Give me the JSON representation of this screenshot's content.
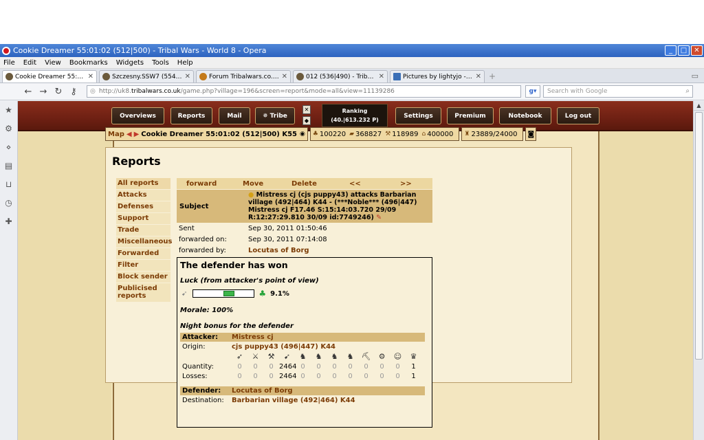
{
  "browser": {
    "window_title": "Cookie Dreamer 55:01:02 (512|500) - Tribal Wars - World 8 - Opera",
    "menu": [
      "File",
      "Edit",
      "View",
      "Bookmarks",
      "Widgets",
      "Tools",
      "Help"
    ],
    "tabs": [
      {
        "label": "Cookie Dreamer 55:01:0..."
      },
      {
        "label": "Szczesny.SSW7 (554|61..."
      },
      {
        "label": "Forum Tribalwars.co.uk -..."
      },
      {
        "label": "012 (536|490) - Tribal W..."
      },
      {
        "label": "Pictures by lightyjo - Pho..."
      }
    ],
    "url_prefix": "http://uk8.",
    "url_domain": "tribalwars.co.uk",
    "url_path": "/game.php?village=196&screen=report&mode=all&view=11139286",
    "search_placeholder": "Search with Google"
  },
  "game": {
    "nav": {
      "overviews": "Overviews",
      "reports": "Reports",
      "mail": "Mail",
      "tribe": "Tribe",
      "ranking_label": "Ranking",
      "ranking_value": "(40.|613.232 P)",
      "settings": "Settings",
      "premium": "Premium",
      "notebook": "Notebook",
      "logout": "Log out"
    },
    "infobar": {
      "map": "Map",
      "village": "Cookie Dreamer 55:01:02 (512|500) K55",
      "wood": "100220",
      "clay": "368827",
      "iron": "118989",
      "storage": "400000",
      "farm": "23889/24000"
    },
    "page_title": "Reports",
    "submenu": [
      "All reports",
      "Attacks",
      "Defenses",
      "Support",
      "Trade",
      "Miscellaneous",
      "Forwarded",
      "Filter",
      "Block sender",
      "Publicised reports"
    ],
    "actions": [
      "forward",
      "Move",
      "Delete",
      "<<",
      ">>"
    ],
    "subject_label": "Subject",
    "subject_value": "Mistress cj (cjs puppy43) attacks Barbarian village (492|464) K44 - (***Noble*** (496|447) Mistress cj F17.46 S:15:14:03.720 29/09 R:12:27:29.810 30/09 id:7749246)",
    "sent_label": "Sent",
    "sent_value": "Sep 30, 2011 01:50:46",
    "fwd_on_label": "forwarded on:",
    "fwd_on_value": "Sep 30, 2011 07:14:08",
    "fwd_by_label": "forwarded by:",
    "fwd_by_value": "Locutas of Borg",
    "result_title": "The defender has won",
    "luck_label": "Luck (from attacker's point of view)",
    "luck_value": "9.1%",
    "luck_fraction": 0.091,
    "morale": "Morale: 100%",
    "night_bonus": "Night bonus for the defender",
    "attacker_label": "Attacker:",
    "attacker_name": "Mistress cj",
    "origin_label": "Origin:",
    "origin_value": "cjs puppy43 (496|447) K44",
    "quantity_label": "Quantity:",
    "losses_label": "Losses:",
    "attacker_quantity": [
      "0",
      "0",
      "0",
      "2464",
      "0",
      "0",
      "0",
      "0",
      "0",
      "0",
      "0",
      "1"
    ],
    "attacker_losses": [
      "0",
      "0",
      "0",
      "2464",
      "0",
      "0",
      "0",
      "0",
      "0",
      "0",
      "0",
      "1"
    ],
    "defender_label": "Defender:",
    "defender_name": "Locutas of Borg",
    "destination_label": "Destination:",
    "destination_value": "Barbarian village (492|464) K44"
  }
}
